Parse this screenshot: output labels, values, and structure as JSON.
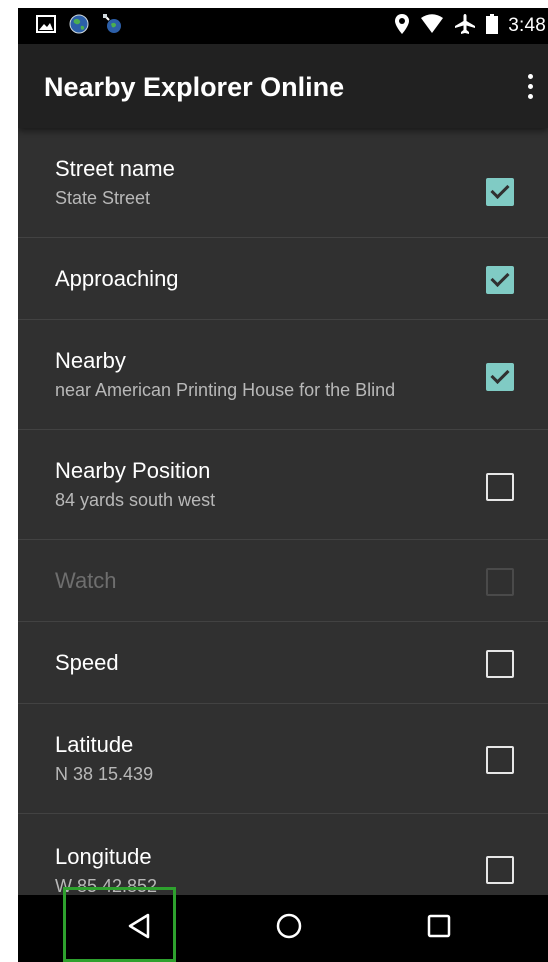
{
  "status_bar": {
    "time": "3:48",
    "left_icons": [
      "gallery-icon",
      "globe-icon",
      "satellite-icon"
    ],
    "right_icons": [
      "location-icon",
      "wifi-icon",
      "airplane-icon",
      "battery-icon"
    ]
  },
  "app_bar": {
    "title": "Nearby Explorer Online",
    "menu_icon": "overflow-menu-icon"
  },
  "settings": [
    {
      "title": "Street name",
      "subtitle": "State Street",
      "checked": true,
      "enabled": true
    },
    {
      "title": "Approaching",
      "subtitle": "",
      "checked": true,
      "enabled": true
    },
    {
      "title": "Nearby",
      "subtitle": "near American Printing House for the Blind",
      "checked": true,
      "enabled": true
    },
    {
      "title": "Nearby Position",
      "subtitle": "84 yards south west",
      "checked": false,
      "enabled": true
    },
    {
      "title": "Watch",
      "subtitle": "",
      "checked": false,
      "enabled": false
    },
    {
      "title": "Speed",
      "subtitle": "",
      "checked": false,
      "enabled": true
    },
    {
      "title": "Latitude",
      "subtitle": "N 38 15.439",
      "checked": false,
      "enabled": true
    },
    {
      "title": "Longitude",
      "subtitle": "W 85 42.852",
      "checked": false,
      "enabled": true
    }
  ],
  "nav_bar": {
    "buttons": [
      "back-icon",
      "home-icon",
      "recents-icon"
    ],
    "highlight_color": "#2ea12e"
  },
  "colors": {
    "background": "#303030",
    "app_bar": "#212121",
    "checkbox_accent": "#80cbc4"
  }
}
